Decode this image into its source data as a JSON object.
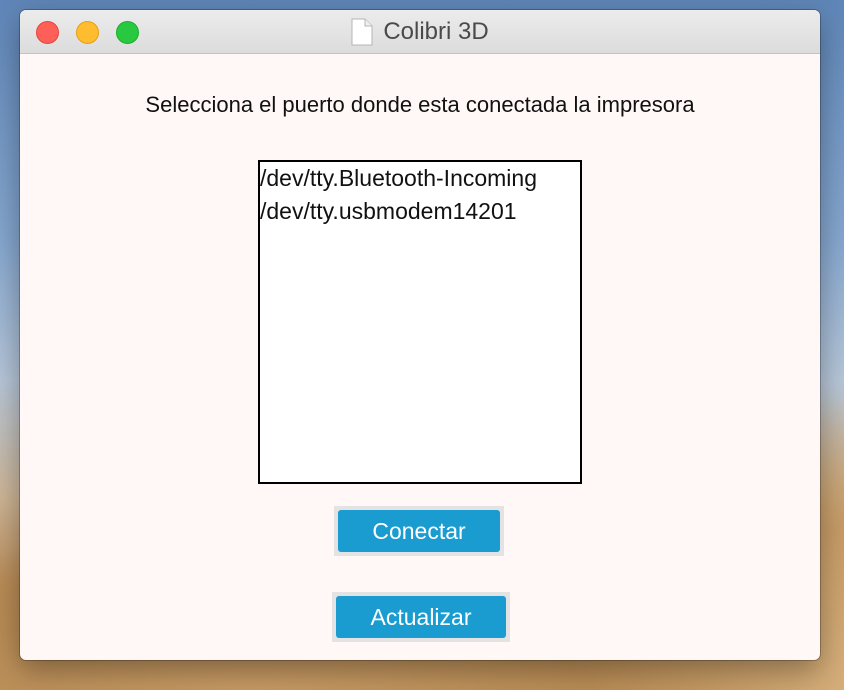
{
  "window": {
    "title": "Colibri 3D"
  },
  "main": {
    "prompt": "Selecciona el puerto donde esta conectada la impresora",
    "ports": [
      "/dev/tty.Bluetooth-Incoming",
      "/dev/tty.usbmodem14201"
    ],
    "connect_label": "Conectar",
    "refresh_label": "Actualizar"
  },
  "colors": {
    "button": "#1a9cd0",
    "window_bg": "#fff8f7",
    "close": "#fe5f57",
    "minimize": "#febc2e",
    "maximize": "#28c840"
  },
  "icons": {
    "title": "document-icon"
  }
}
